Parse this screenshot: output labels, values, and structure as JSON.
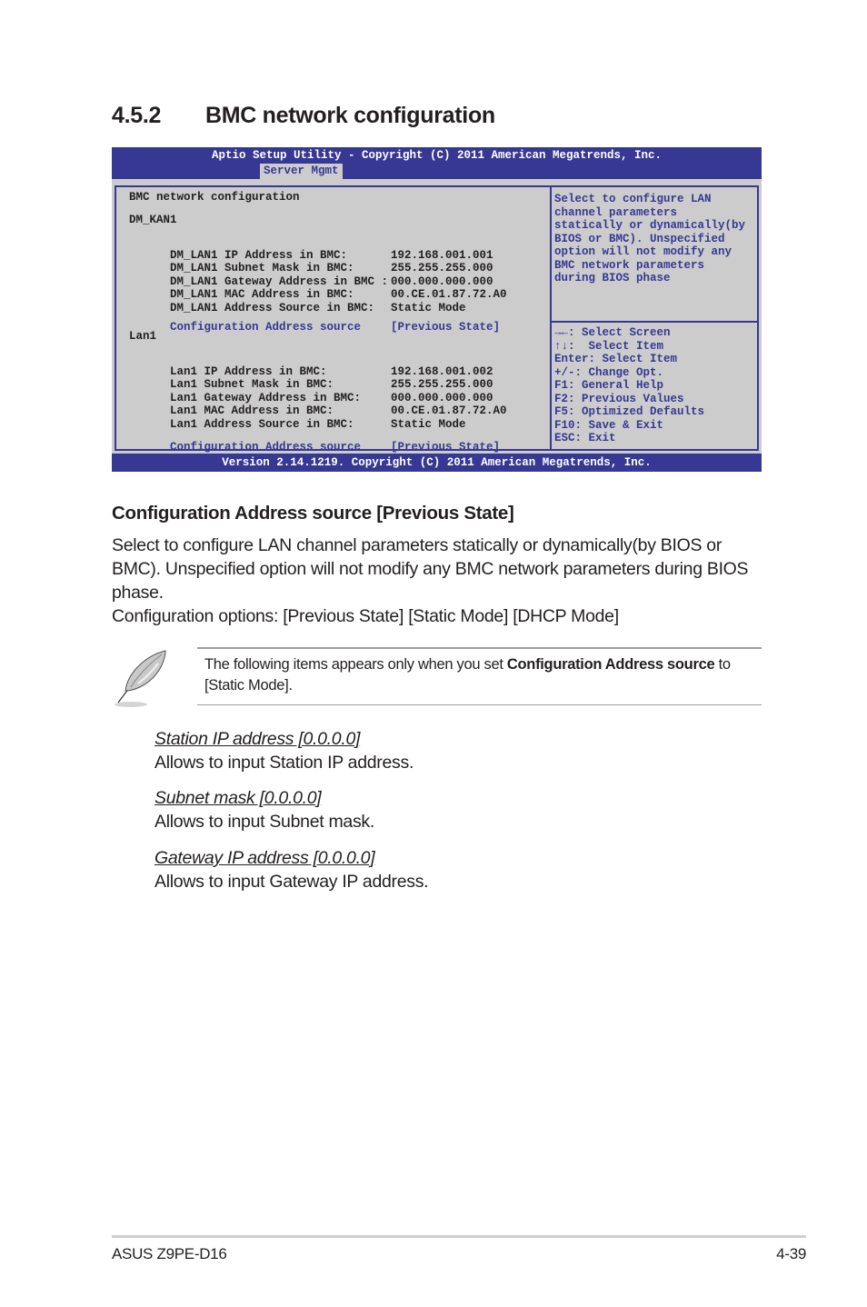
{
  "section": {
    "number": "4.5.2",
    "title": "BMC network configuration"
  },
  "bios": {
    "header_title": "Aptio Setup Utility - Copyright (C) 2011 American Megatrends, Inc.",
    "active_tab": "Server Mgmt",
    "footer": "Version 2.14.1219. Copyright (C) 2011 American Megatrends, Inc.",
    "colors": {
      "bar": "#363893",
      "panel": "#cccccc",
      "highlight_text": "#363893"
    },
    "page_heading": "BMC network configuration",
    "group1": {
      "heading": "DM_KAN1",
      "rows": [
        {
          "label": "DM_LAN1 IP Address in BMC:",
          "value": "192.168.001.001"
        },
        {
          "label": "DM_LAN1 Subnet Mask in BMC:",
          "value": "255.255.255.000"
        },
        {
          "label": "DM_LAN1 Gateway Address in BMC :",
          "value": "000.000.000.000"
        },
        {
          "label": "DM_LAN1 MAC Address in BMC:",
          "value": "00.CE.01.87.72.A0"
        },
        {
          "label": "DM_LAN1 Address Source in BMC:",
          "value": "Static Mode"
        }
      ],
      "setting": {
        "label": "Configuration Address source",
        "value": "[Previous State]"
      }
    },
    "group2": {
      "heading": "Lan1",
      "rows": [
        {
          "label": "Lan1 IP Address in BMC:",
          "value": "192.168.001.002"
        },
        {
          "label": "Lan1 Subnet Mask in BMC:",
          "value": "255.255.255.000"
        },
        {
          "label": "Lan1 Gateway Address in BMC:",
          "value": "000.000.000.000"
        },
        {
          "label": "Lan1 MAC Address in BMC:",
          "value": "00.CE.01.87.72.A0"
        },
        {
          "label": "Lan1 Address Source in BMC:",
          "value": "Static Mode"
        }
      ],
      "setting": {
        "label": "Configuration Address source",
        "value": "[Previous State]"
      }
    },
    "help_text": "Select to configure LAN\nchannel parameters\nstatically or dynamically(by\nBIOS or BMC). Unspecified\noption will not modify any\nBMC network parameters\nduring BIOS phase",
    "keys": [
      "→←: Select Screen",
      "↑↓:  Select Item",
      "Enter: Select Item",
      "+/-: Change Opt.",
      "F1: General Help",
      "F2: Previous Values",
      "F5: Optimized Defaults",
      "F10: Save & Exit",
      "ESC: Exit"
    ]
  },
  "body": {
    "subtitle": "Configuration Address source [Previous State]",
    "paragraph": "Select to configure LAN channel parameters statically or dynamically(by BIOS or BMC). Unspecified option will not modify any BMC network parameters during BIOS phase.",
    "options": "Configuration options: [Previous State] [Static Mode] [DHCP Mode]",
    "note": {
      "icon": "feather-pen-icon",
      "text_before": "The following items appears only when you set ",
      "text_bold": "Configuration Address source",
      "text_after": " to [Static Mode]."
    },
    "items": [
      {
        "label": "Station IP address [0.0.0.0]",
        "desc": "Allows to input Station IP address."
      },
      {
        "label": "Subnet mask [0.0.0.0]",
        "desc": "Allows to input Subnet mask."
      },
      {
        "label": "Gateway IP address [0.0.0.0]",
        "desc": "Allows to input Gateway IP address."
      }
    ]
  },
  "footer": {
    "product": "ASUS Z9PE-D16",
    "page": "4-39"
  }
}
